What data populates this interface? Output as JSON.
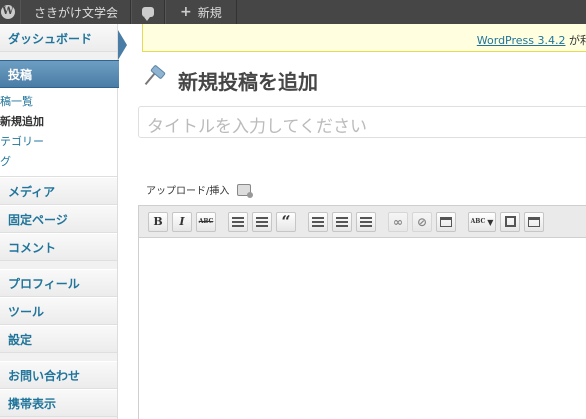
{
  "adminbar": {
    "logo": "W",
    "site_name": "さきがけ文学会",
    "new_label": "新規"
  },
  "sidebar": {
    "dashboard": "ダッシュボード",
    "posts": "投稿",
    "submenu": [
      "稿一覧",
      "新規追加",
      "テゴリー",
      "グ"
    ],
    "media": "メディア",
    "pages": "固定ページ",
    "comments": "コメント",
    "profile": "プロフィール",
    "tools": "ツール",
    "settings": "設定",
    "contact": "お問い合わせ",
    "mobile": "携帯表示"
  },
  "notice": {
    "link": "WordPress 3.4.2",
    "tail": " が利"
  },
  "page_title": "新規投稿を追加",
  "title_input": {
    "placeholder": "タイトルを入力してください"
  },
  "media": {
    "label": "アップロード/挿入"
  },
  "toolbar": {
    "bold": "B",
    "italic": "I",
    "strike": "ABC",
    "quote": "“",
    "spell": "ABC"
  },
  "colors": {
    "accent": "#21759b",
    "current": "#4a7da6",
    "adminbar": "#464646"
  }
}
